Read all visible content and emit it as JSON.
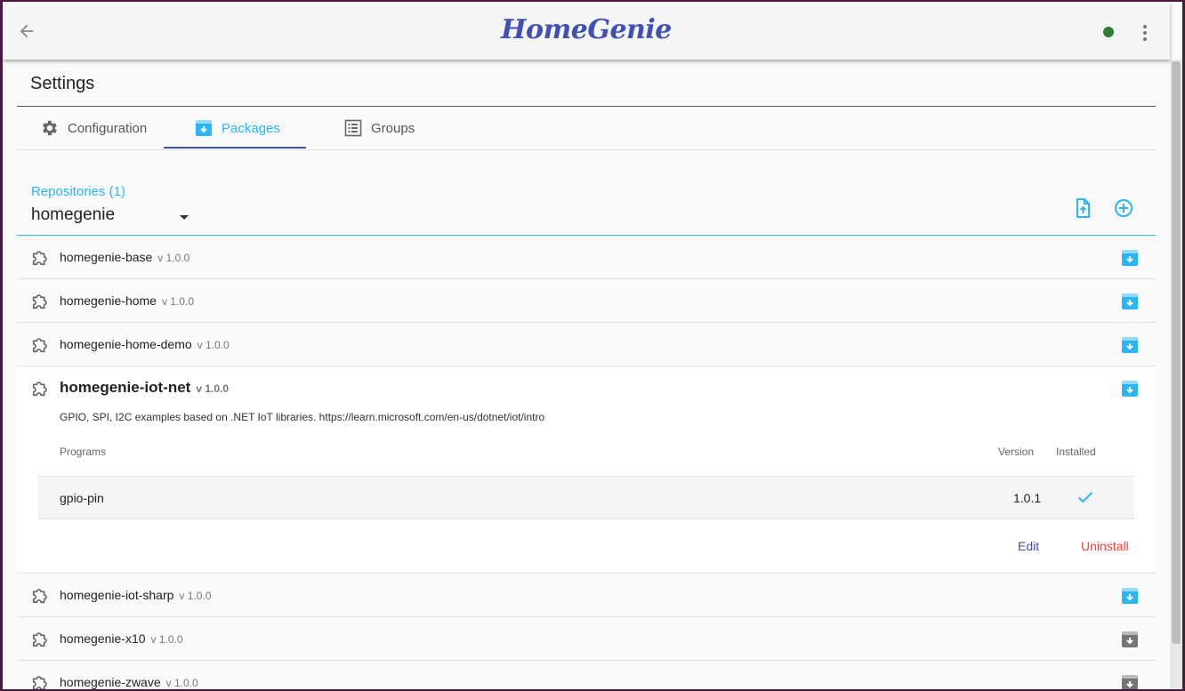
{
  "header": {
    "logo": "HomeGenie"
  },
  "settings": {
    "title": "Settings"
  },
  "tabs": [
    {
      "label": "Configuration"
    },
    {
      "label": "Packages"
    },
    {
      "label": "Groups"
    }
  ],
  "repositories": {
    "label": "Repositories (1)",
    "selected": "homegenie"
  },
  "packages": [
    {
      "name": "homegenie-base",
      "version": "v 1.0.0"
    },
    {
      "name": "homegenie-home",
      "version": "v 1.0.0"
    },
    {
      "name": "homegenie-home-demo",
      "version": "v 1.0.0"
    },
    {
      "name": "homegenie-iot-net",
      "version": "v 1.0.0",
      "description": "GPIO, SPI, I2C examples based on .NET IoT libraries. https://learn.microsoft.com/en-us/dotnet/iot/intro",
      "columns": {
        "programs": "Programs",
        "version": "Version",
        "installed": "Installed"
      },
      "programs": [
        {
          "name": "gpio-pin",
          "version": "1.0.1"
        }
      ],
      "actions": {
        "edit": "Edit",
        "uninstall": "Uninstall"
      }
    },
    {
      "name": "homegenie-iot-sharp",
      "version": "v 1.0.0"
    },
    {
      "name": "homegenie-x10",
      "version": "v 1.0.0"
    },
    {
      "name": "homegenie-zwave",
      "version": "v 1.0.0"
    }
  ],
  "colors": {
    "accent": "#29b6f6",
    "primary": "#3f51b5",
    "danger": "#f44336",
    "status_online": "#2e7d32",
    "icon_grey": "#757575"
  }
}
